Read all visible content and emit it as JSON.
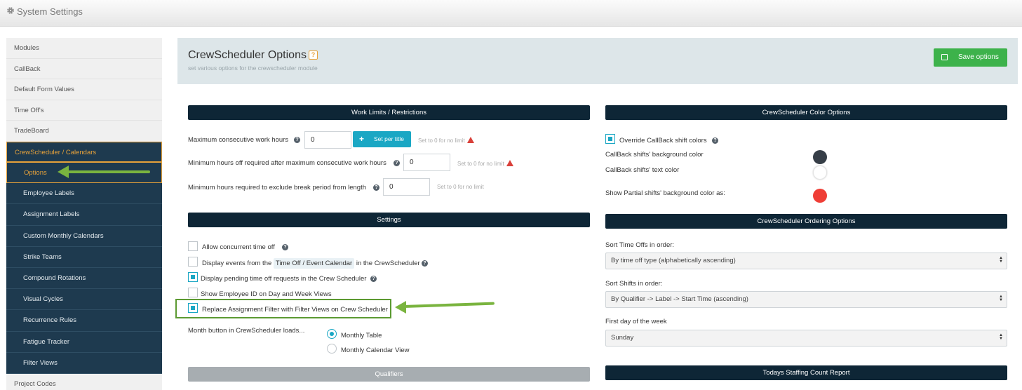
{
  "topbar": {
    "title": "System Settings",
    "icon": "gear-icon"
  },
  "sidebar": {
    "items": [
      {
        "label": "Modules"
      },
      {
        "label": "CallBack"
      },
      {
        "label": "Default Form Values"
      },
      {
        "label": "Time Off's"
      },
      {
        "label": "TradeBoard"
      },
      {
        "label": "CrewScheduler / Calendars"
      }
    ],
    "subitems": [
      {
        "label": "Options"
      },
      {
        "label": "Employee Labels"
      },
      {
        "label": "Assignment Labels"
      },
      {
        "label": "Custom Monthly Calendars"
      },
      {
        "label": "Strike Teams"
      },
      {
        "label": "Compound Rotations"
      },
      {
        "label": "Visual Cycles"
      },
      {
        "label": "Recurrence Rules"
      },
      {
        "label": "Fatigue Tracker"
      },
      {
        "label": "Filter Views"
      }
    ],
    "after": [
      {
        "label": "Project Codes"
      }
    ]
  },
  "header": {
    "title": "CrewScheduler Options",
    "help": "?",
    "subtitle": "set various options for the crewscheduler module",
    "save_label": "Save options"
  },
  "work_limits": {
    "heading": "Work Limits / Restrictions",
    "max_consecutive_label": "Maximum consecutive work hours",
    "max_consecutive_value": "0",
    "set_per_title_label": "Set per title",
    "hint_no_limit": "Set to 0 for no limit",
    "min_off_label": "Minimum hours off required after maximum consecutive work hours",
    "min_off_value": "0",
    "break_label": "Minimum hours required to exclude break period from length",
    "break_value": "0"
  },
  "settings": {
    "heading": "Settings",
    "allow_concurrent": "Allow concurrent time off",
    "display_events_pre": "Display events from the",
    "display_events_tag": "Time Off / Event Calendar",
    "display_events_post": "in the CrewScheduler",
    "display_pending": "Display pending time off requests in the Crew Scheduler",
    "show_employee_id": "Show Employee ID on Day and Week Views",
    "replace_filter": "Replace Assignment Filter with Filter Views on Crew Scheduler",
    "month_button_label": "Month button in CrewScheduler loads...",
    "month_options": [
      "Monthly Table",
      "Monthly Calendar View"
    ]
  },
  "qualifiers": {
    "heading": "Qualifiers"
  },
  "color_options": {
    "heading": "CrewScheduler Color Options",
    "override_label": "Override CallBack shift colors",
    "bg_label": "CallBack shifts' background color",
    "text_label": "CallBack shifts' text color",
    "partial_label": "Show Partial shifts' background color as:",
    "colors": {
      "bg": "#363e47",
      "text": "#ffffff",
      "partial": "#ef3e36"
    }
  },
  "ordering": {
    "heading": "CrewScheduler Ordering Options",
    "time_offs_label": "Sort Time Offs in order:",
    "time_offs_value": "By time off type (alphabetically ascending)",
    "shifts_label": "Sort Shifts in order:",
    "shifts_value": "By Qualifier -> Label -> Start Time (ascending)",
    "first_day_label": "First day of the week",
    "first_day_value": "Sunday"
  },
  "staffing": {
    "heading": "Todays Staffing Count Report"
  },
  "theme": {
    "accent": "#1aa7c4",
    "navy": "#0e2636",
    "save_green": "#3db24b",
    "arrow_green": "#7ab43f",
    "sidebar_active": "#e7a23a"
  }
}
